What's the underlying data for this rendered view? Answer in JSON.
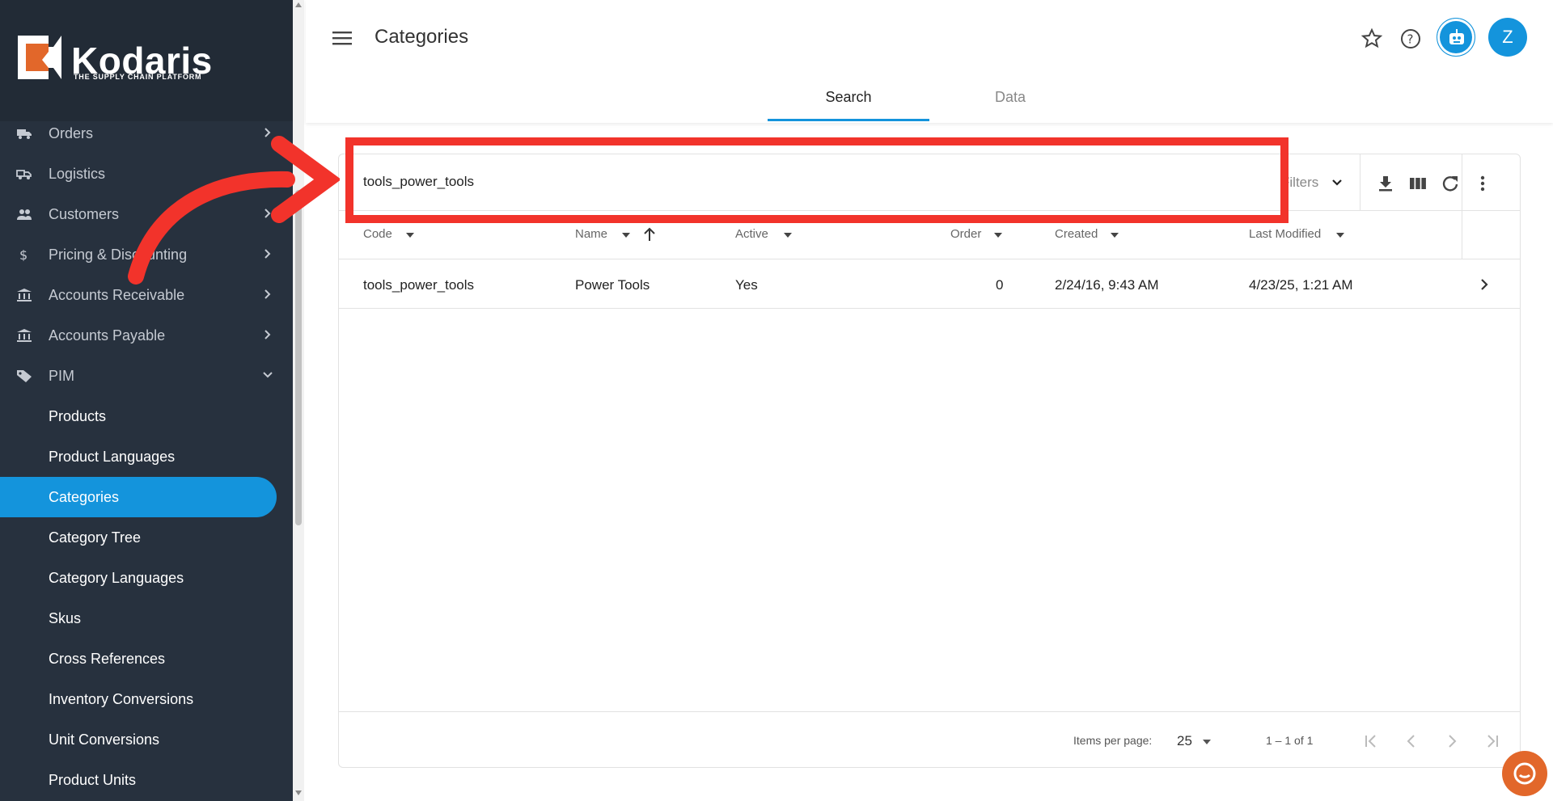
{
  "brand": {
    "name": "Kodaris",
    "tagline": "THE SUPPLY CHAIN PLATFORM"
  },
  "sidebar": {
    "items": [
      {
        "label": "Orders",
        "icon": "truck-icon"
      },
      {
        "label": "Logistics",
        "icon": "delivery-icon"
      },
      {
        "label": "Customers",
        "icon": "people-icon"
      },
      {
        "label": "Pricing & Discounting",
        "icon": "dollar-icon"
      },
      {
        "label": "Accounts Receivable",
        "icon": "bank-icon"
      },
      {
        "label": "Accounts Payable",
        "icon": "bank-icon"
      },
      {
        "label": "PIM",
        "icon": "tag-icon"
      }
    ],
    "pim_children": [
      {
        "label": "Products"
      },
      {
        "label": "Product Languages"
      },
      {
        "label": "Categories"
      },
      {
        "label": "Category Tree"
      },
      {
        "label": "Category Languages"
      },
      {
        "label": "Skus"
      },
      {
        "label": "Cross References"
      },
      {
        "label": "Inventory Conversions"
      },
      {
        "label": "Unit Conversions"
      },
      {
        "label": "Product Units"
      }
    ],
    "active_item": "Categories"
  },
  "header": {
    "title": "Categories",
    "avatar_initial": "Z",
    "tabs": [
      {
        "label": "Search",
        "active": true
      },
      {
        "label": "Data",
        "active": false
      }
    ]
  },
  "search": {
    "value": "tools_power_tools",
    "filters_label": "Filters"
  },
  "table": {
    "columns": [
      "Code",
      "Name",
      "Active",
      "Order",
      "Created",
      "Last Modified"
    ],
    "rows": [
      {
        "code": "tools_power_tools",
        "name": "Power Tools",
        "active": "Yes",
        "order": "0",
        "created": "2/24/16, 9:43 AM",
        "modified": "4/23/25, 1:21 AM"
      }
    ]
  },
  "pager": {
    "items_per_page_label": "Items per page:",
    "items_per_page": "25",
    "range": "1 – 1 of 1"
  },
  "colors": {
    "accent": "#1494dc",
    "sidebar_bg": "#27313e",
    "highlight": "#f2332b",
    "logo_orange": "#e2672a"
  }
}
